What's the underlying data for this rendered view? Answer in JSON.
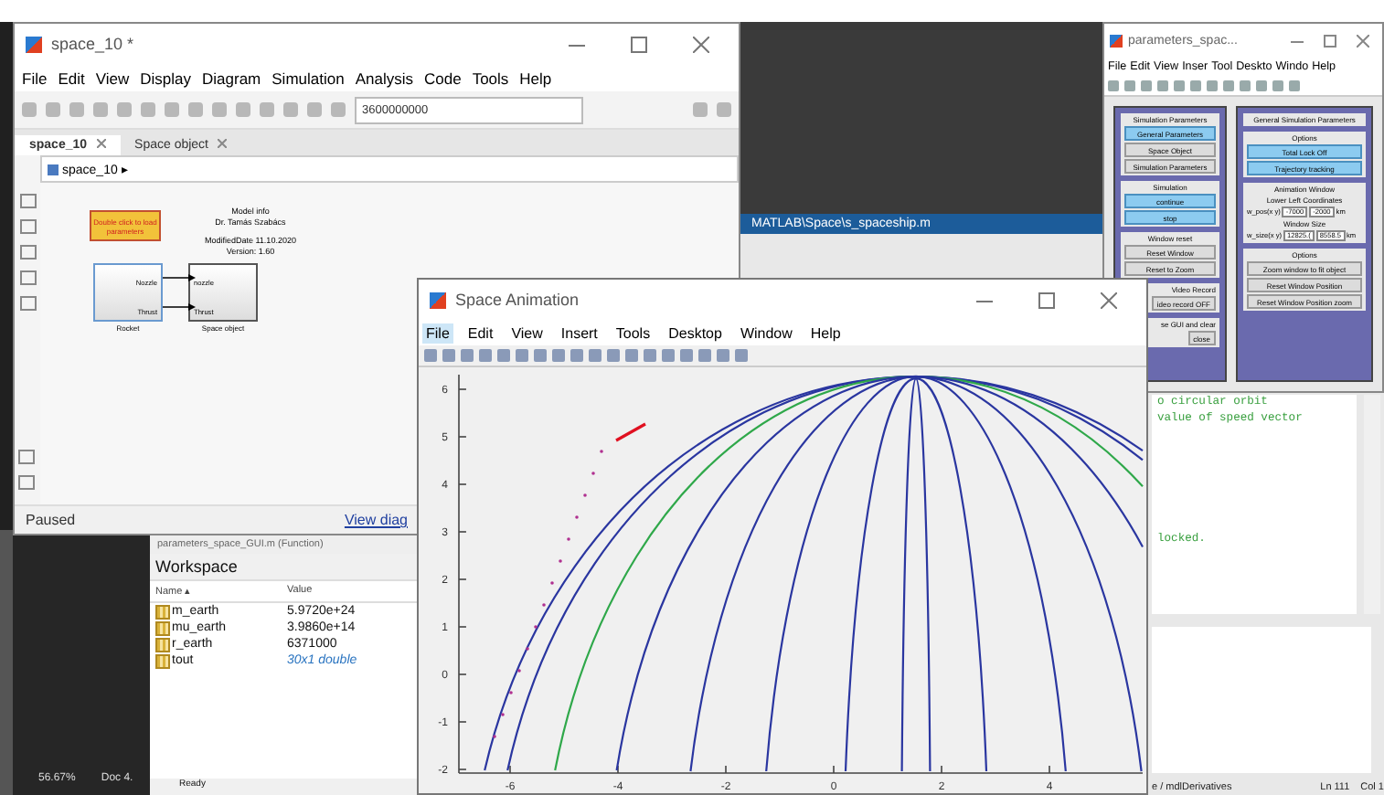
{
  "simulink": {
    "title": "space_10 *",
    "menu": [
      "File",
      "Edit",
      "View",
      "Display",
      "Diagram",
      "Simulation",
      "Analysis",
      "Code",
      "Tools",
      "Help"
    ],
    "stop_time": "3600000000",
    "tabs": [
      {
        "label": "space_10",
        "selected": true
      },
      {
        "label": "Space object",
        "selected": false
      }
    ],
    "breadcrumb": "space_10 ▸",
    "note_block": "Double click to load parameters",
    "model_info": [
      "Model info",
      "Dr. Tamás Szabács",
      "ModifiedDate 11.10.2020",
      "Version: 1.60"
    ],
    "blocks": [
      {
        "name": "Rocket",
        "ports": [
          "Nozzle",
          "Thrust"
        ]
      },
      {
        "name": "Space object",
        "ports": [
          "nozzle",
          "Thrust"
        ]
      }
    ],
    "status": "Paused",
    "link": "View diag"
  },
  "editor": {
    "path": "MATLAB\\Space\\s_spaceship.m",
    "code_lines": [
      "o circular orbit",
      "value of speed vector"
    ],
    "code_end": "locked.",
    "function_label": "parameters_space_GUI.m (Function)",
    "context": "e / mdlDerivatives",
    "line": "Ln 111",
    "column": "Col 1"
  },
  "workspace": {
    "title": "Workspace",
    "columns": [
      "Name ▴",
      "Value"
    ],
    "rows": [
      {
        "name": "m_earth",
        "value": "5.9720e+24",
        "kind": "number"
      },
      {
        "name": "mu_earth",
        "value": "3.9860e+14",
        "kind": "number"
      },
      {
        "name": "r_earth",
        "value": "6371000",
        "kind": "number"
      },
      {
        "name": "tout",
        "value": "30x1 double",
        "kind": "array"
      }
    ],
    "status": "Ready"
  },
  "taskbar": {
    "zoom": "56.67%",
    "doc": "Doc 4."
  },
  "parameters": {
    "title": "parameters_spac...",
    "menu": [
      "File",
      "Edit",
      "View",
      "Inser",
      "Tool",
      "Deskto",
      "Windo",
      "Help"
    ],
    "left_groups": [
      {
        "title": "Simulation Parameters",
        "buttons": [
          {
            "label": "General Parameters",
            "selected": true
          },
          {
            "label": "Space Object",
            "selected": false
          },
          {
            "label": "Simulation Parameters",
            "selected": false
          }
        ]
      },
      {
        "title": "Simulation",
        "buttons": [
          {
            "label": "continue",
            "selected": true
          },
          {
            "label": "stop",
            "selected": true
          }
        ]
      },
      {
        "title": "Window reset",
        "buttons": [
          {
            "label": "Reset Window",
            "selected": false
          },
          {
            "label": "Reset to Zoom",
            "selected": false
          }
        ]
      },
      {
        "title": "Video Record",
        "buttons": [
          {
            "label": "ideo record OFF",
            "selected": false
          }
        ]
      },
      {
        "title": "se GUI and clear",
        "buttons": [
          {
            "label": "close",
            "selected": false
          }
        ]
      }
    ],
    "right_title": "General Simulation Parameters",
    "options_title": "Options",
    "options": [
      {
        "label": "Total Lock Off",
        "selected": true
      },
      {
        "label": "Trajectory tracking",
        "selected": true
      }
    ],
    "animation_title": "Animation Window",
    "lower_left_label": "Lower Left Coordinates",
    "pos_label": "w_pos(x y)",
    "pos_values": [
      "-7000",
      "-2000"
    ],
    "pos_unit": "km",
    "size_title": "Window Size",
    "size_label": "w_size(x y)",
    "size_values": [
      "12825.(",
      "8558.5"
    ],
    "size_unit": "km",
    "options2_title": "Options",
    "options2": [
      "Zoom window to fit object",
      "Reset Window Position",
      "Reset Window Position zoom"
    ]
  },
  "animation": {
    "title": "Space Animation",
    "menu": [
      {
        "label": "File",
        "selected": true
      },
      {
        "label": "Edit",
        "selected": false
      },
      {
        "label": "View",
        "selected": false
      },
      {
        "label": "Insert",
        "selected": false
      },
      {
        "label": "Tools",
        "selected": false
      },
      {
        "label": "Desktop",
        "selected": false
      },
      {
        "label": "Window",
        "selected": false
      },
      {
        "label": "Help",
        "selected": false
      }
    ],
    "yticks": [
      "6",
      "5",
      "4",
      "3",
      "2",
      "1",
      "0",
      "-1",
      "-2"
    ],
    "xticks": [
      "-6",
      "-4",
      "-2",
      "0",
      "2",
      "4"
    ]
  }
}
